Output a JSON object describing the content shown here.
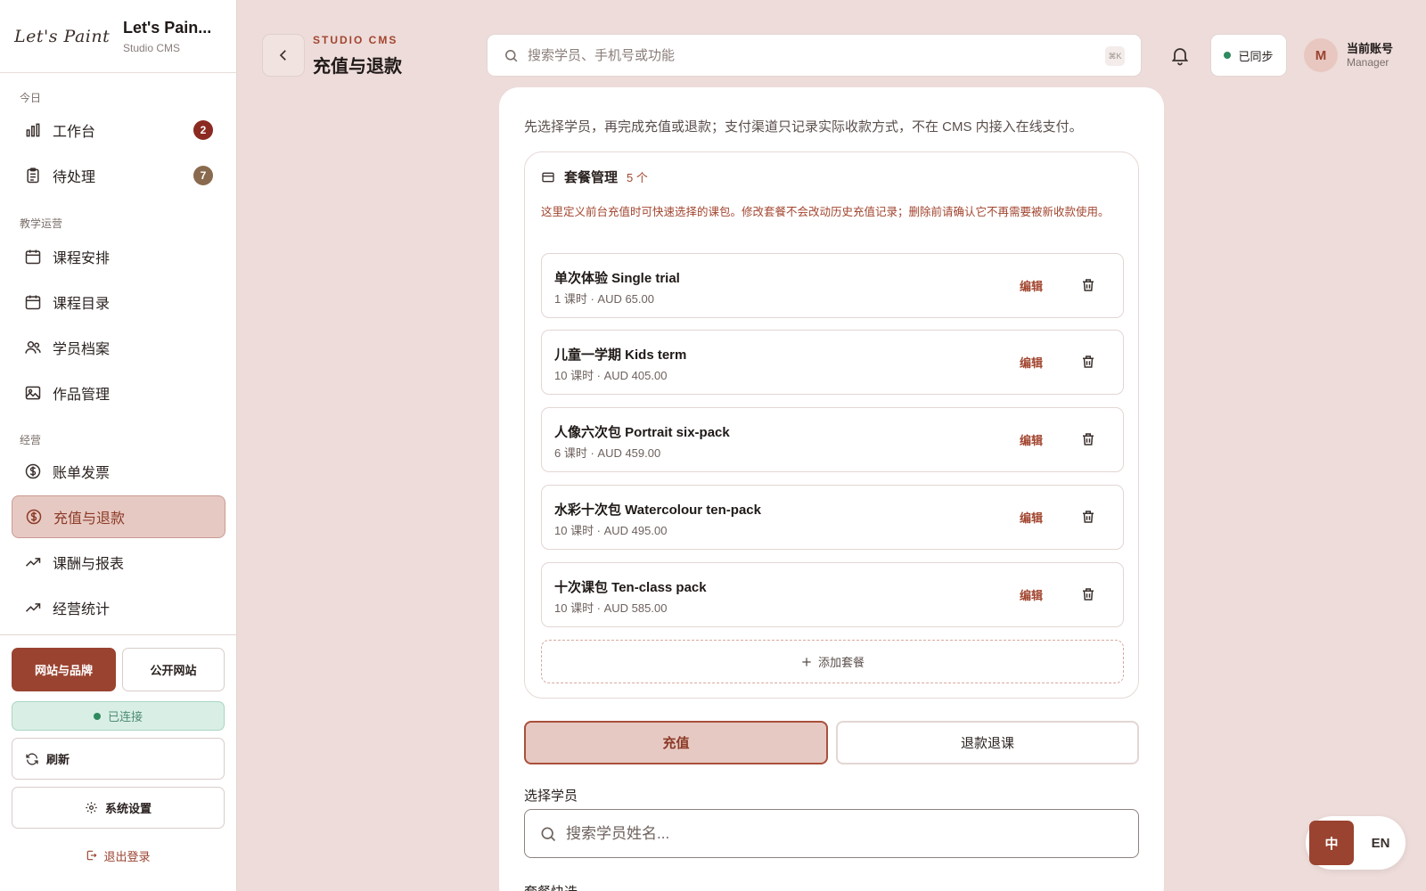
{
  "brand": {
    "script_logo": "Let's Paint",
    "title": "Let's Pain...",
    "subtitle": "Studio CMS"
  },
  "sidebar": {
    "sections": {
      "today": "今日",
      "teaching": "教学运营",
      "business": "经营"
    },
    "items": [
      {
        "label": "工作台",
        "icon": "bar-chart-icon",
        "badge": "2",
        "badge_color": "#8b2a20"
      },
      {
        "label": "待处理",
        "icon": "clipboard-icon",
        "badge": "7",
        "badge_color": "#8a6a4e"
      },
      {
        "label": "课程安排",
        "icon": "calendar-icon"
      },
      {
        "label": "课程目录",
        "icon": "calendar-icon"
      },
      {
        "label": "学员档案",
        "icon": "users-icon"
      },
      {
        "label": "作品管理",
        "icon": "image-icon"
      },
      {
        "label": "账单发票",
        "icon": "dollar-circle-icon"
      },
      {
        "label": "充值与退款",
        "icon": "dollar-circle-icon",
        "active": true
      },
      {
        "label": "课酬与报表",
        "icon": "trend-icon"
      },
      {
        "label": "经营统计",
        "icon": "trend-icon"
      }
    ],
    "website_brand_label": "网站与品牌",
    "public_site_label": "公开网站",
    "connected_label": "已连接",
    "refresh_label": "刷新",
    "settings_label": "系统设置",
    "logout_label": "退出登录"
  },
  "header": {
    "crumb": "STUDIO CMS",
    "title": "充值与退款",
    "search_placeholder": "搜索学员、手机号或功能",
    "shortcut": "⌘K",
    "sync_label": "已同步",
    "avatar_initial": "M",
    "account_name": "当前账号",
    "account_role": "Manager"
  },
  "main": {
    "intro": "先选择学员，再完成充值或退款；支付渠道只记录实际收款方式，不在 CMS 内接入在线支付。",
    "packages": {
      "title": "套餐管理",
      "count": "5 个",
      "note": "这里定义前台充值时可快速选择的课包。修改套餐不会改动历史充值记录；删除前请确认它不再需要被新收款使用。",
      "edit_label": "编辑",
      "add_label": "添加套餐",
      "items": [
        {
          "name": "单次体验 Single trial",
          "meta": "1 课时 · AUD 65.00"
        },
        {
          "name": "儿童一学期 Kids term",
          "meta": "10 课时 · AUD 405.00"
        },
        {
          "name": "人像六次包 Portrait six-pack",
          "meta": "6 课时 · AUD 459.00"
        },
        {
          "name": "水彩十次包 Watercolour ten-pack",
          "meta": "10 课时 · AUD 495.00"
        },
        {
          "name": "十次课包 Ten-class pack",
          "meta": "10 课时 · AUD 585.00"
        }
      ]
    },
    "tabs": {
      "recharge": "充值",
      "refund": "退款退课"
    },
    "select_student_label": "选择学员",
    "student_search_placeholder": "搜索学员姓名...",
    "quick_pick_label": "套餐快选"
  },
  "lang": {
    "zh": "中",
    "en": "EN"
  },
  "colors": {
    "accent": "#9a4330",
    "active_bg": "#e7c9c3",
    "page_bg": "#eddcda",
    "connected_bg": "#d9efe5"
  }
}
